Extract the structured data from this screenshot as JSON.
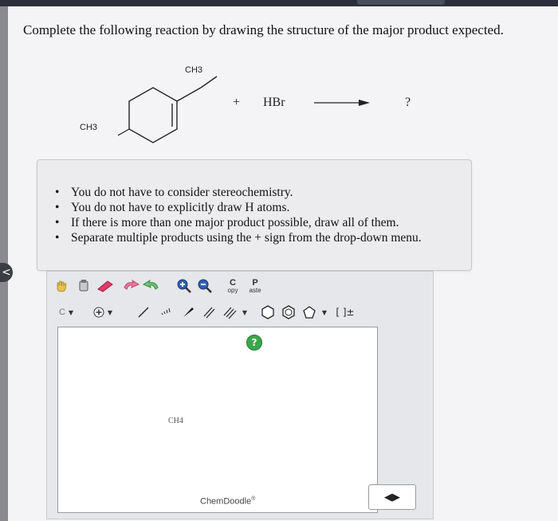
{
  "question": {
    "prompt": "Complete the following reaction by drawing the structure of the major product expected."
  },
  "reaction": {
    "substituent_top": "CH3",
    "substituent_left": "CH3",
    "plus": "+",
    "reagent": "HBr",
    "product": "?"
  },
  "notes": {
    "items": [
      "You do not have to consider stereochemistry.",
      "You do not have to explicitly draw H atoms.",
      "If there is more than one major product possible, draw all of them.",
      "Separate multiple products using the + sign from the drop-down menu."
    ]
  },
  "toolbar": {
    "copy_top": "C",
    "copy_bottom": "opy",
    "paste_top": "P",
    "paste_bottom": "aste",
    "atom_label": "C",
    "charge_label": "[ ]±"
  },
  "canvas": {
    "ch4_label": "CH4",
    "help_label": "?",
    "brand": "ChemDoodle",
    "brand_mark": "®"
  },
  "navigation": {
    "left_handle": "<",
    "resize_arrows": "◀▶"
  },
  "colors": {
    "help_green": "#3aa84a",
    "toolbar_gray": "#e6e7ea"
  }
}
